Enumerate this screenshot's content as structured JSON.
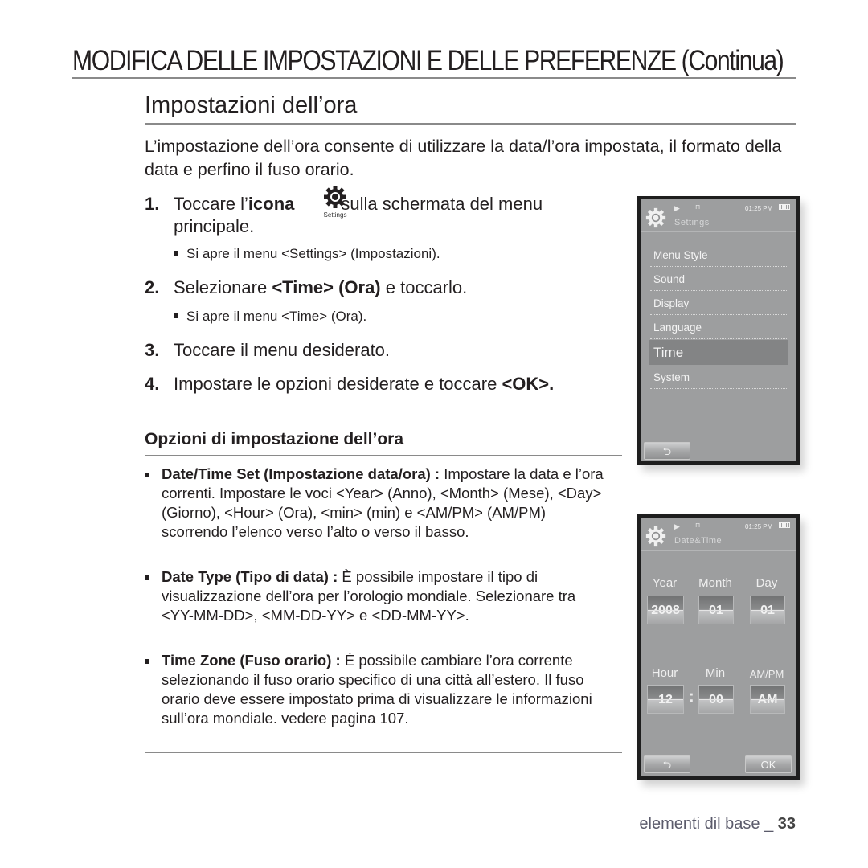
{
  "page": {
    "main_title": "MODIFICA DELLE IMPOSTAZIONI E DELLE PREFERENZE (Continua)",
    "section_title": "Impostazioni dell’ora",
    "intro": "L’impostazione dell’ora consente di utilizzare la data/l’ora impostata, il formato della data e perfino il fuso orario."
  },
  "steps": [
    {
      "num": "1.",
      "text_before": "Toccare l’",
      "bold": "icona",
      "text_after": "sulla schermata del menu",
      "line2": "principale.",
      "icon": "settings-gear-icon",
      "icon_label": "Settings",
      "sub": "Si apre il menu <Settings> (Impostazioni)."
    },
    {
      "num": "2.",
      "text_before": "Selezionare ",
      "bold": "<Time> (Ora)",
      "text_after": " e toccarlo.",
      "sub": "Si apre il menu <Time> (Ora)."
    },
    {
      "num": "3.",
      "text": "Toccare il menu desiderato."
    },
    {
      "num": "4.",
      "text_before": "Impostare le opzioni desiderate e toccare ",
      "bold": "<OK>."
    }
  ],
  "options": {
    "title": "Opzioni di impostazione dell’ora",
    "items": [
      {
        "term": "Date/Time Set (Impostazione data/ora) :",
        "desc": " Impostare la data e l’ora correnti. Impostare le voci <Year> (Anno), <Month> (Mese), <Day> (Giorno), <Hour> (Ora), <min> (min) e <AM/PM> (AM/PM) scorrendo l’elenco verso l’alto o verso il basso."
      },
      {
        "term": "Date Type (Tipo di data) :",
        "desc": " È possibile impostare il tipo di visualizzazione dell’ora per l’orologio mondiale. Selezionare tra <YY-MM-DD>, <MM-DD-YY> e <DD-MM-YY>."
      },
      {
        "term": "Time Zone (Fuso orario) :",
        "desc": " È possibile cambiare l’ora corrente selezionando il fuso orario specifico di una città all’estero. Il fuso orario deve essere impostato prima di visualizzare le informazioni sull’ora mondiale. vedere pagina 107."
      }
    ]
  },
  "device_settings": {
    "clock": "01:25 PM",
    "title": "Settings",
    "play_icon": "▶",
    "usb_icon": "⊓",
    "menu": [
      "Menu Style",
      "Sound",
      "Display",
      "Language",
      "Time",
      "System"
    ],
    "selected": "Time",
    "back_icon": "⮌"
  },
  "device_datetime": {
    "clock": "01:25 PM",
    "title": "Date&Time",
    "play_icon": "▶",
    "usb_icon": "⊓",
    "labels_row1": [
      "Year",
      "Month",
      "Day"
    ],
    "values_row1": [
      "2008",
      "01",
      "01"
    ],
    "labels_row2": [
      "Hour",
      "Min",
      "AM/PM"
    ],
    "values_row2": [
      "12",
      "00",
      "AM"
    ],
    "separator": ":",
    "back_icon": "⮌",
    "ok_label": "OK"
  },
  "footer": {
    "text": "elementi dil base _ ",
    "page": "33"
  }
}
